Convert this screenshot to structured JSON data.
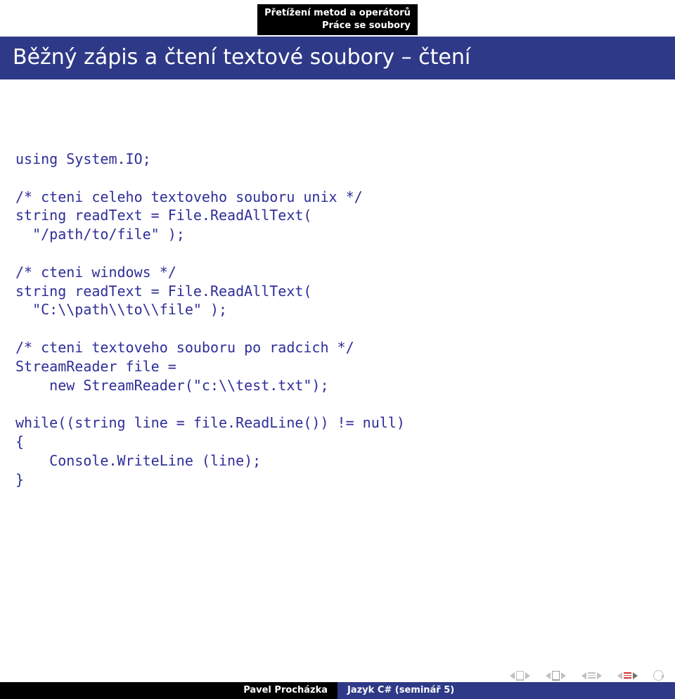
{
  "breadcrumb": {
    "line1": "Přetížení metod a operátorů",
    "line2": "Práce se soubory"
  },
  "title": "Běžný zápis a čtení textové soubory – čtení",
  "code": "using System.IO;\n\n/* cteni celeho textoveho souboru unix */\nstring readText = File.ReadAllText(\n  \"/path/to/file\" );\n\n/* cteni windows */\nstring readText = File.ReadAllText(\n  \"C:\\\\path\\\\to\\\\file\" );\n\n/* cteni textoveho souboru po radcich */\nStreamReader file =\n    new StreamReader(\"c:\\\\test.txt\");\n\nwhile((string line = file.ReadLine()) != null)\n{\n    Console.WriteLine (line);\n}",
  "footer": {
    "author": "Pavel Procházka",
    "subject": "Jazyk C# (seminář 5)"
  }
}
